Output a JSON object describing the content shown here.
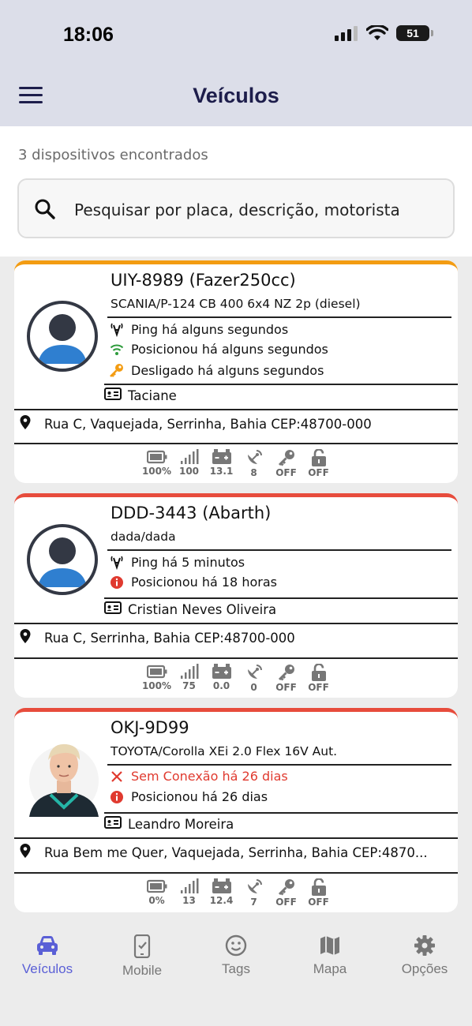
{
  "status_bar": {
    "time": "18:06",
    "battery": "51"
  },
  "header": {
    "title": "Veículos"
  },
  "list": {
    "count_text": "3 dispositivos encontrados"
  },
  "search": {
    "placeholder": "Pesquisar por placa, descrição, motorista"
  },
  "colors": {
    "orange": "#f39c12",
    "red": "#e74c3c",
    "accent": "#5a5fd6",
    "green": "#2e9b3c",
    "alert_red": "#e03a2f"
  },
  "vehicles": [
    {
      "plate": "UIY-8989 (Fazer250cc)",
      "model": "SCANIA/P-124 CB 400 6x4 NZ 2p (diesel)",
      "ping": "Ping há alguns segundos",
      "position": "Posicionou há alguns segundos",
      "ignition": "Desligado há alguns segundos",
      "driver": "Taciane",
      "address": "Rua C, Vaquejada, Serrinha, Bahia CEP:48700-000",
      "metrics": [
        "100%",
        "100",
        "13.1",
        "8",
        "OFF",
        "OFF"
      ]
    },
    {
      "plate": "DDD-3443 (Abarth)",
      "model": "dada/dada",
      "ping": "Ping há 5 minutos",
      "position": "Posicionou há 18 horas",
      "driver": "Cristian Neves Oliveira",
      "address": "Rua C, Serrinha, Bahia CEP:48700-000",
      "metrics": [
        "100%",
        "75",
        "0.0",
        "0",
        "OFF",
        "OFF"
      ]
    },
    {
      "plate": "OKJ-9D99",
      "model": "TOYOTA/Corolla XEi 2.0 Flex 16V Aut.",
      "connection": "Sem Conexão há 26 dias",
      "position": "Posicionou há 26 dias",
      "driver": "Leandro Moreira",
      "address": "Rua Bem me Quer, Vaquejada, Serrinha, Bahia CEP:4870...",
      "metrics": [
        "0%",
        "13",
        "12.4",
        "7",
        "OFF",
        "OFF"
      ]
    }
  ],
  "nav": {
    "items": [
      "Veículos",
      "Mobile",
      "Tags",
      "Mapa",
      "Opções"
    ],
    "active": "Veículos"
  },
  "icons": [
    "search-icon",
    "menu-icon",
    "signal-tower-icon",
    "wifi-icon",
    "key-icon",
    "alert-icon",
    "close-icon",
    "id-card-icon",
    "location-pin-icon",
    "battery-icon",
    "signal-bars-icon",
    "car-battery-icon",
    "satellite-icon",
    "lock-icon",
    "car-icon",
    "phone-check-icon",
    "smile-icon",
    "map-icon",
    "gear-icon"
  ]
}
